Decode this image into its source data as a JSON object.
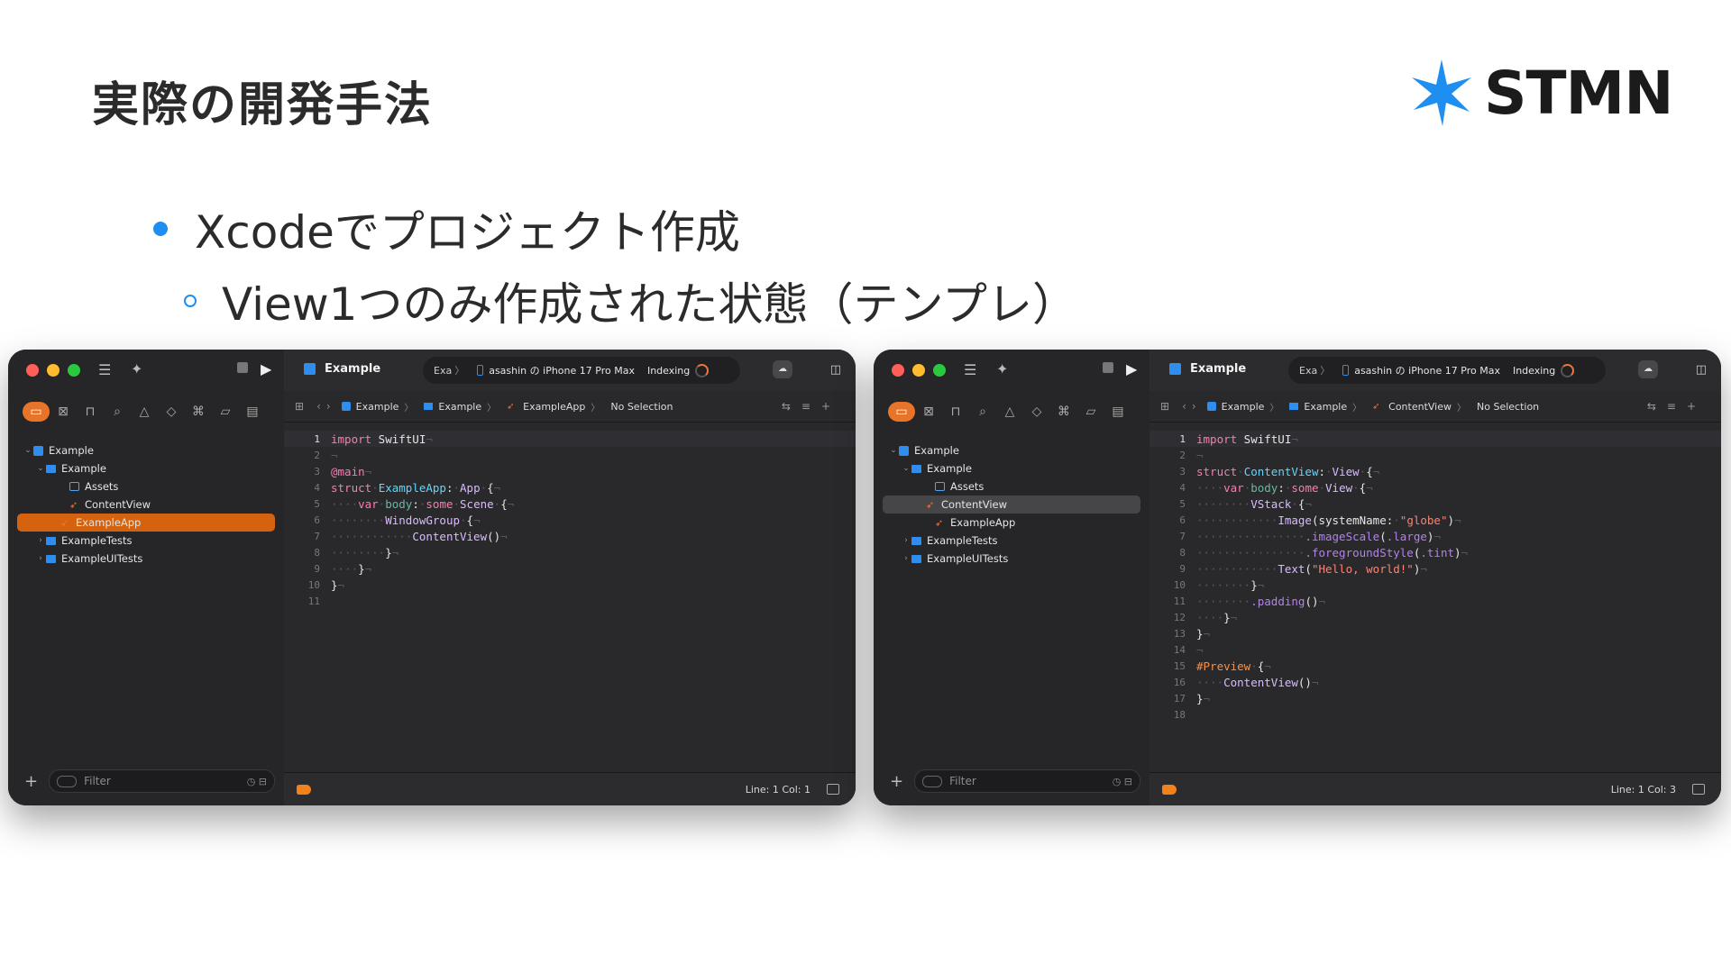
{
  "slide": {
    "title": "実際の開発手法",
    "bullet1": "Xcodeでプロジェクト作成",
    "bullet2": "View1つのみ作成された状態（テンプレ）",
    "logo_text": "STMN",
    "accent": "#1f8ef1"
  },
  "windows": [
    {
      "project": "Example",
      "scheme_short": "Exa",
      "device": "asashin の iPhone 17  Pro Max",
      "status_label": "Indexing",
      "tree": [
        {
          "label": "Example",
          "icon": "project-icon",
          "chev": "⌄",
          "indent": 6,
          "sel": ""
        },
        {
          "label": "Example",
          "icon": "folder-icon",
          "chev": "⌄",
          "indent": 20,
          "sel": ""
        },
        {
          "label": "Assets",
          "icon": "assets-icon",
          "chev": "",
          "indent": 46,
          "sel": ""
        },
        {
          "label": "ContentView",
          "icon": "swift-icon",
          "chev": "",
          "indent": 46,
          "sel": ""
        },
        {
          "label": "ExampleApp",
          "icon": "swift-icon",
          "chev": "",
          "indent": 36,
          "sel": "orange"
        },
        {
          "label": "ExampleTests",
          "icon": "folder-icon",
          "chev": "›",
          "indent": 20,
          "sel": ""
        },
        {
          "label": "ExampleUITests",
          "icon": "folder-icon",
          "chev": "›",
          "indent": 20,
          "sel": ""
        }
      ],
      "crumbs": [
        "Example",
        "Example",
        "ExampleApp",
        "No Selection"
      ],
      "code": [
        [
          [
            "import",
            "kw"
          ],
          [
            " SwiftUI",
            "p"
          ],
          [
            "¬",
            "i"
          ]
        ],
        [
          [
            "¬",
            "i"
          ]
        ],
        [
          [
            "@main",
            "kw"
          ],
          [
            "¬",
            "i"
          ]
        ],
        [
          [
            "struct",
            "kw"
          ],
          [
            "·",
            "i"
          ],
          [
            "ExampleApp",
            "ty"
          ],
          [
            ":",
            "p"
          ],
          [
            "·",
            "i"
          ],
          [
            "App",
            "t2"
          ],
          [
            "·",
            "i"
          ],
          [
            "{",
            "p"
          ],
          [
            "¬",
            "i"
          ]
        ],
        [
          [
            "····",
            "i"
          ],
          [
            "var",
            "kw"
          ],
          [
            "·",
            "i"
          ],
          [
            "body",
            "pr"
          ],
          [
            ":",
            "p"
          ],
          [
            "·",
            "i"
          ],
          [
            "some",
            "kw"
          ],
          [
            "·",
            "i"
          ],
          [
            "Scene",
            "t2"
          ],
          [
            "·",
            "i"
          ],
          [
            "{",
            "p"
          ],
          [
            "¬",
            "i"
          ]
        ],
        [
          [
            "········",
            "i"
          ],
          [
            "WindowGroup",
            "t2"
          ],
          [
            "·",
            "i"
          ],
          [
            "{",
            "p"
          ],
          [
            "¬",
            "i"
          ]
        ],
        [
          [
            "············",
            "i"
          ],
          [
            "ContentView",
            "t2"
          ],
          [
            "()",
            "p"
          ],
          [
            "¬",
            "i"
          ]
        ],
        [
          [
            "········",
            "i"
          ],
          [
            "}",
            "p"
          ],
          [
            "¬",
            "i"
          ]
        ],
        [
          [
            "····",
            "i"
          ],
          [
            "}",
            "p"
          ],
          [
            "¬",
            "i"
          ]
        ],
        [
          [
            "}",
            "p"
          ],
          [
            "¬",
            "i"
          ]
        ],
        []
      ],
      "status_pos": "Line: 1  Col: 1"
    },
    {
      "project": "Example",
      "scheme_short": "Exa",
      "device": "asashin の iPhone 17  Pro Max",
      "status_label": "Indexing",
      "tree": [
        {
          "label": "Example",
          "icon": "project-icon",
          "chev": "⌄",
          "indent": 6,
          "sel": ""
        },
        {
          "label": "Example",
          "icon": "folder-icon",
          "chev": "⌄",
          "indent": 20,
          "sel": ""
        },
        {
          "label": "Assets",
          "icon": "assets-icon",
          "chev": "",
          "indent": 46,
          "sel": ""
        },
        {
          "label": "ContentView",
          "icon": "swift-icon",
          "chev": "",
          "indent": 36,
          "sel": "gray"
        },
        {
          "label": "ExampleApp",
          "icon": "swift-icon",
          "chev": "",
          "indent": 46,
          "sel": ""
        },
        {
          "label": "ExampleTests",
          "icon": "folder-icon",
          "chev": "›",
          "indent": 20,
          "sel": ""
        },
        {
          "label": "ExampleUITests",
          "icon": "folder-icon",
          "chev": "›",
          "indent": 20,
          "sel": ""
        }
      ],
      "crumbs": [
        "Example",
        "Example",
        "ContentView",
        "No Selection"
      ],
      "code": [
        [
          [
            "import",
            "kw"
          ],
          [
            " SwiftUI",
            "p"
          ],
          [
            "¬",
            "i"
          ]
        ],
        [
          [
            "¬",
            "i"
          ]
        ],
        [
          [
            "struct",
            "kw"
          ],
          [
            "·",
            "i"
          ],
          [
            "ContentView",
            "ty"
          ],
          [
            ":",
            "p"
          ],
          [
            "·",
            "i"
          ],
          [
            "View",
            "t2"
          ],
          [
            "·",
            "i"
          ],
          [
            "{",
            "p"
          ],
          [
            "¬",
            "i"
          ]
        ],
        [
          [
            "····",
            "i"
          ],
          [
            "var",
            "kw"
          ],
          [
            "·",
            "i"
          ],
          [
            "body",
            "pr"
          ],
          [
            ":",
            "p"
          ],
          [
            "·",
            "i"
          ],
          [
            "some",
            "kw"
          ],
          [
            "·",
            "i"
          ],
          [
            "View",
            "t2"
          ],
          [
            "·",
            "i"
          ],
          [
            "{",
            "p"
          ],
          [
            "¬",
            "i"
          ]
        ],
        [
          [
            "········",
            "i"
          ],
          [
            "VStack",
            "t2"
          ],
          [
            "·",
            "i"
          ],
          [
            "{",
            "p"
          ],
          [
            "¬",
            "i"
          ]
        ],
        [
          [
            "············",
            "i"
          ],
          [
            "Image",
            "t2"
          ],
          [
            "(systemName:",
            "p"
          ],
          [
            "·",
            "i"
          ],
          [
            "\"globe\"",
            "st"
          ],
          [
            ")",
            "p"
          ],
          [
            "¬",
            "i"
          ]
        ],
        [
          [
            "················",
            "i"
          ],
          [
            ".imageScale",
            "mt"
          ],
          [
            "(",
            "p"
          ],
          [
            ".large",
            "mt"
          ],
          [
            ")",
            "p"
          ],
          [
            "¬",
            "i"
          ]
        ],
        [
          [
            "················",
            "i"
          ],
          [
            ".foregroundStyle",
            "mt"
          ],
          [
            "(",
            "p"
          ],
          [
            ".tint",
            "mt"
          ],
          [
            ")",
            "p"
          ],
          [
            "¬",
            "i"
          ]
        ],
        [
          [
            "············",
            "i"
          ],
          [
            "Text",
            "t2"
          ],
          [
            "(",
            "p"
          ],
          [
            "\"Hello, world!\"",
            "st"
          ],
          [
            ")",
            "p"
          ],
          [
            "¬",
            "i"
          ]
        ],
        [
          [
            "········",
            "i"
          ],
          [
            "}",
            "p"
          ],
          [
            "¬",
            "i"
          ]
        ],
        [
          [
            "········",
            "i"
          ],
          [
            ".padding",
            "mt"
          ],
          [
            "()",
            "p"
          ],
          [
            "¬",
            "i"
          ]
        ],
        [
          [
            "····",
            "i"
          ],
          [
            "}",
            "p"
          ],
          [
            "¬",
            "i"
          ]
        ],
        [
          [
            "}",
            "p"
          ],
          [
            "¬",
            "i"
          ]
        ],
        [
          [
            "¬",
            "i"
          ]
        ],
        [
          [
            "#Preview",
            "kw2"
          ],
          [
            "·",
            "i"
          ],
          [
            "{",
            "p"
          ],
          [
            "¬",
            "i"
          ]
        ],
        [
          [
            "····",
            "i"
          ],
          [
            "ContentView",
            "t2"
          ],
          [
            "()",
            "p"
          ],
          [
            "¬",
            "i"
          ]
        ],
        [
          [
            "}",
            "p"
          ],
          [
            "¬",
            "i"
          ]
        ],
        []
      ],
      "status_pos": "Line: 1  Col: 3"
    }
  ],
  "sidebar_filter_placeholder": "Filter",
  "colors": {
    "kw": "#ff7ab2",
    "kw2": "#fd8f3f",
    "ty": "#5dd8ff",
    "t2": "#dabaff",
    "pr": "#67b7a4",
    "st": "#ff8170",
    "mt": "#b281eb",
    "p": "#e6e6e6",
    "i": "#565660"
  }
}
